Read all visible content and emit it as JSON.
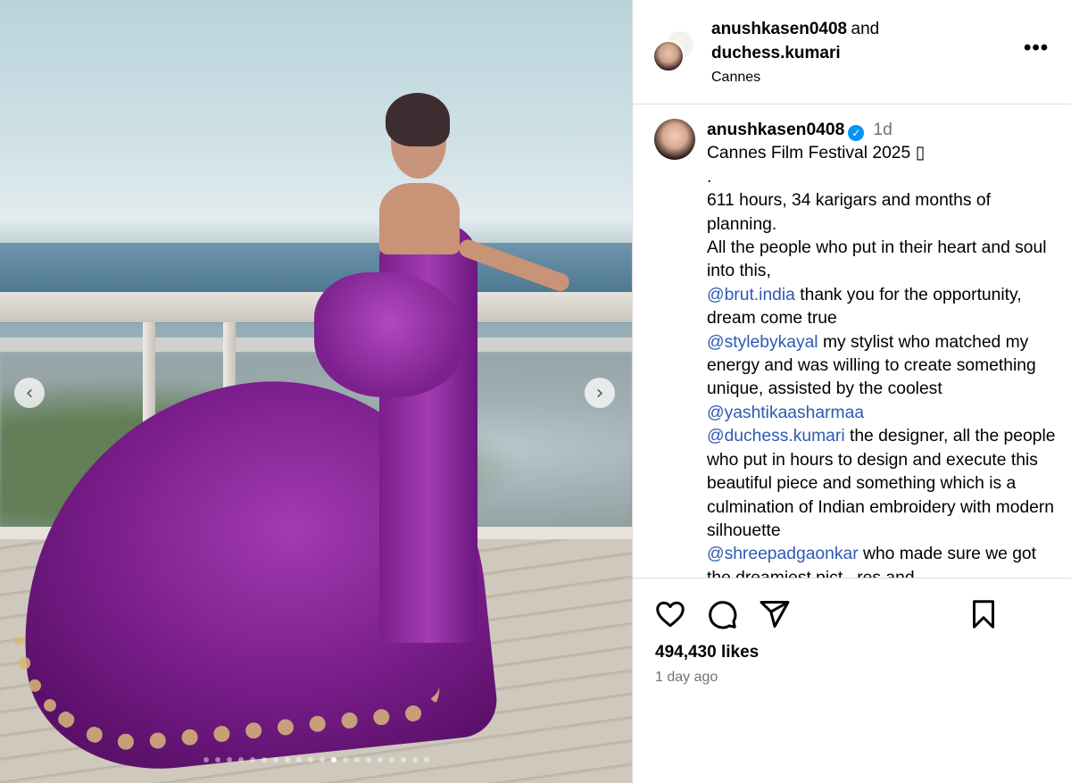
{
  "media": {
    "prev_label": "‹",
    "next_label": "›",
    "slide_count": 20,
    "active_slide": 11
  },
  "header": {
    "user1": "anushkasen0408",
    "and_text": "and",
    "user2": "duchess.kumari",
    "location": "Cannes",
    "more_label": "•••"
  },
  "caption": {
    "username": "anushkasen0408",
    "time": "1d",
    "lines": [
      {
        "type": "text",
        "text": "Cannes Film Festival 2025 ▯"
      },
      {
        "type": "text",
        "text": "."
      },
      {
        "type": "text",
        "text": "611 hours, 34 karigars and months of planning."
      },
      {
        "type": "text",
        "text": "All the people who put in their heart and soul into this,"
      },
      {
        "type": "mention",
        "mention": "@brut.india",
        "text": " thank you for the opportunity, dream come true"
      },
      {
        "type": "mention",
        "mention": "@stylebykayal",
        "text": " my stylist who matched my energy and was willing to create something unique, assisted by the coolest"
      },
      {
        "type": "mention",
        "mention": "@yashtikaasharmaa",
        "text": ""
      },
      {
        "type": "mention",
        "mention": "@duchess.kumari",
        "text": " the designer, all the people who put in hours to design and execute this beautiful piece and something which is a culmination of Indian embroidery with modern silhouette"
      },
      {
        "type": "mention",
        "mention": "@shreepadgaonkar",
        "text": " who made sure we got the dreamiest pict...res and"
      }
    ]
  },
  "actions": {
    "likes": "494,430 likes",
    "time_ago": "1 day ago"
  },
  "colors": {
    "mention": "#2f59b3",
    "verified": "#0095f6",
    "muted": "#737373",
    "border": "#dbdbdb"
  },
  "icons": [
    "heart-icon",
    "comment-icon",
    "share-icon",
    "bookmark-icon",
    "verified-icon",
    "more-icon"
  ]
}
